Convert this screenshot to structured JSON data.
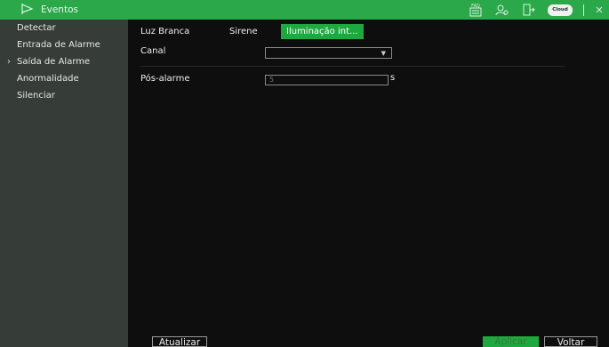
{
  "header": {
    "title": "Eventos",
    "flag_icon": "flag-icon",
    "icons": [
      "faq-icon",
      "user-icon",
      "logout-icon",
      "cloud-icon",
      "close-icon"
    ],
    "faq_label": "FAQ",
    "cloud_label": "Cloud"
  },
  "sidebar": {
    "items": [
      {
        "label": "Detectar"
      },
      {
        "label": "Entrada de Alarme"
      },
      {
        "label": "Saída de Alarme",
        "active": true
      },
      {
        "label": "Anormalidade"
      },
      {
        "label": "Silenciar"
      }
    ],
    "active_marker": "›"
  },
  "tabs": [
    {
      "label": "Luz Branca"
    },
    {
      "label": "Sirene"
    },
    {
      "label": "Iluminação int...",
      "active": true
    }
  ],
  "form": {
    "channel_label": "Canal",
    "channel_value": "",
    "post_alarm_label": "Pós-alarme",
    "post_alarm_value": "5",
    "post_alarm_unit": "s"
  },
  "buttons": {
    "refresh": "Atualizar",
    "apply": "Aplicar",
    "back": "Voltar"
  },
  "colors": {
    "accent": "#1fa83f",
    "topbar": "#2aa84a",
    "sidebar": "#363c37",
    "main": "#0e0e0e"
  }
}
